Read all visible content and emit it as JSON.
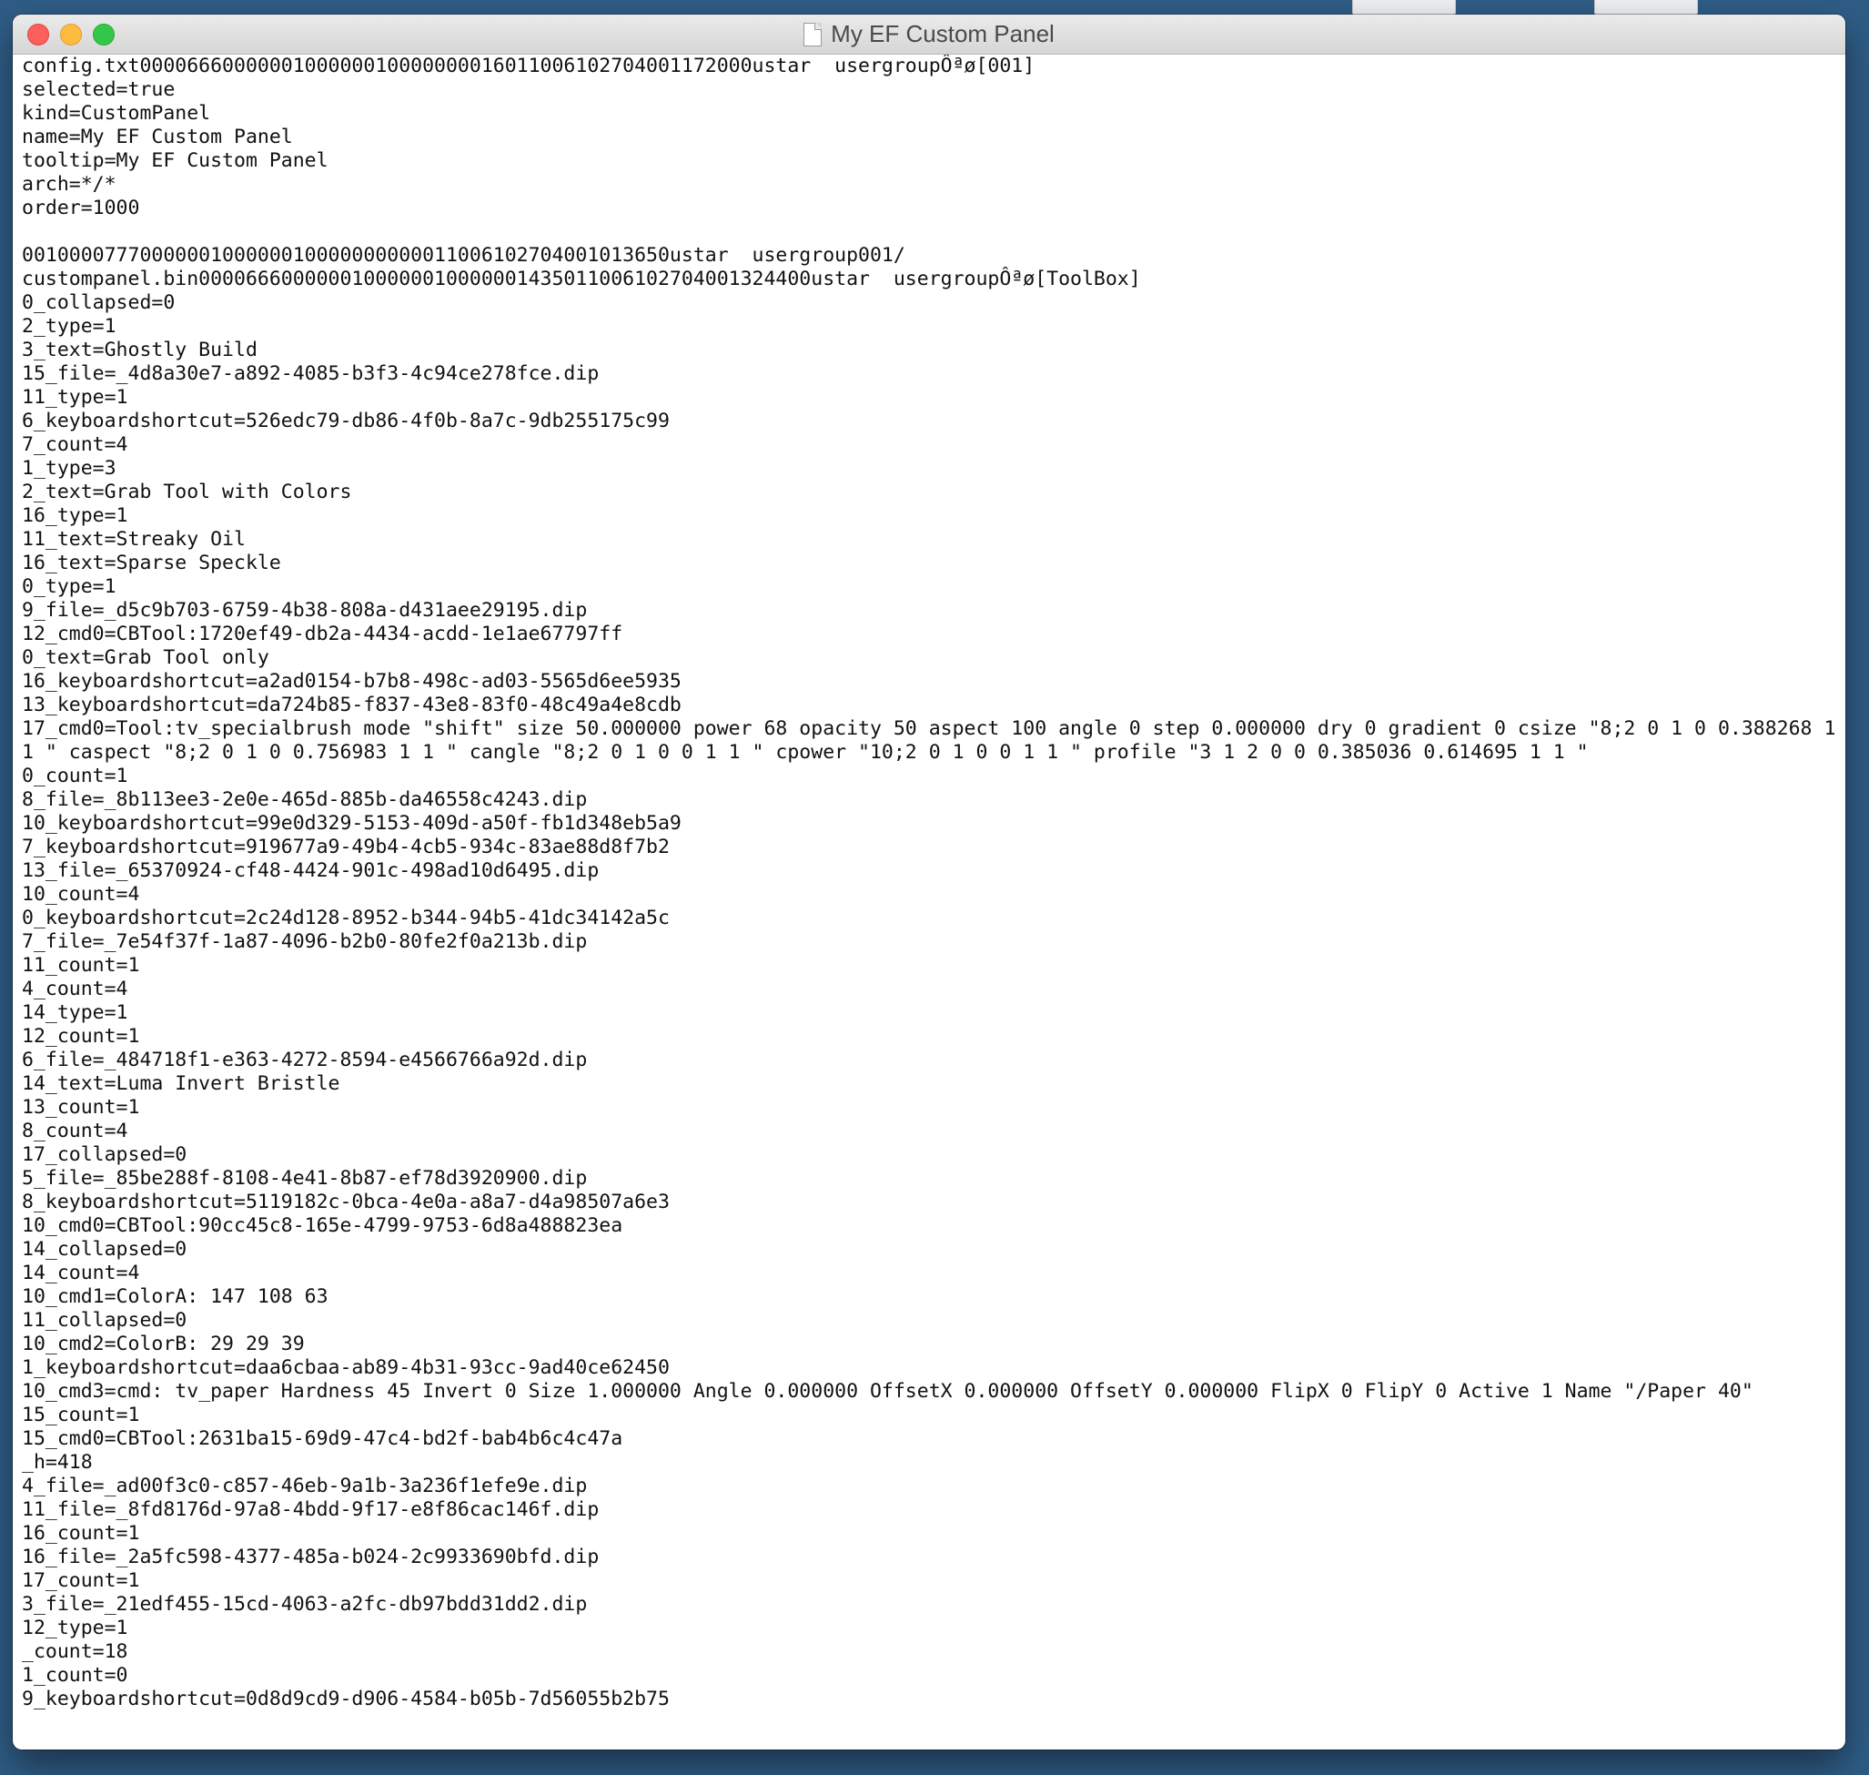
{
  "window": {
    "title": "My EF Custom Panel"
  },
  "document": {
    "text": "config.txt0000666000000100000010000000016011006102704001172000ustar  usergroupÔªø[001]\nselected=true\nkind=CustomPanel\nname=My EF Custom Panel\ntooltip=My EF Custom Panel\narch=*/*\norder=1000\n\n0010000777000000100000010000000000011006102704001013650ustar  usergroup001/\ncustompanel.bin0000666000000100000010000001435011006102704001324400ustar  usergroupÔªø[ToolBox]\n0_collapsed=0\n2_type=1\n3_text=Ghostly Build\n15_file=_4d8a30e7-a892-4085-b3f3-4c94ce278fce.dip\n11_type=1\n6_keyboardshortcut=526edc79-db86-4f0b-8a7c-9db255175c99\n7_count=4\n1_type=3\n2_text=Grab Tool with Colors\n16_type=1\n11_text=Streaky Oil\n16_text=Sparse Speckle\n0_type=1\n9_file=_d5c9b703-6759-4b38-808a-d431aee29195.dip\n12_cmd0=CBTool:1720ef49-db2a-4434-acdd-1e1ae67797ff\n0_text=Grab Tool only\n16_keyboardshortcut=a2ad0154-b7b8-498c-ad03-5565d6ee5935\n13_keyboardshortcut=da724b85-f837-43e8-83f0-48c49a4e8cdb\n17_cmd0=Tool:tv_specialbrush mode \"shift\" size 50.000000 power 68 opacity 50 aspect 100 angle 0 step 0.000000 dry 0 gradient 0 csize \"8;2 0 1 0 0.388268 1 1 \" caspect \"8;2 0 1 0 0.756983 1 1 \" cangle \"8;2 0 1 0 0 1 1 \" cpower \"10;2 0 1 0 0 1 1 \" profile \"3 1 2 0 0 0.385036 0.614695 1 1 \"\n0_count=1\n8_file=_8b113ee3-2e0e-465d-885b-da46558c4243.dip\n10_keyboardshortcut=99e0d329-5153-409d-a50f-fb1d348eb5a9\n7_keyboardshortcut=919677a9-49b4-4cb5-934c-83ae88d8f7b2\n13_file=_65370924-cf48-4424-901c-498ad10d6495.dip\n10_count=4\n0_keyboardshortcut=2c24d128-8952-b344-94b5-41dc34142a5c\n7_file=_7e54f37f-1a87-4096-b2b0-80fe2f0a213b.dip\n11_count=1\n4_count=4\n14_type=1\n12_count=1\n6_file=_484718f1-e363-4272-8594-e4566766a92d.dip\n14_text=Luma Invert Bristle\n13_count=1\n8_count=4\n17_collapsed=0\n5_file=_85be288f-8108-4e41-8b87-ef78d3920900.dip\n8_keyboardshortcut=5119182c-0bca-4e0a-a8a7-d4a98507a6e3\n10_cmd0=CBTool:90cc45c8-165e-4799-9753-6d8a488823ea\n14_collapsed=0\n14_count=4\n10_cmd1=ColorA: 147 108 63\n11_collapsed=0\n10_cmd2=ColorB: 29 29 39\n1_keyboardshortcut=daa6cbaa-ab89-4b31-93cc-9ad40ce62450\n10_cmd3=cmd: tv_paper Hardness 45 Invert 0 Size 1.000000 Angle 0.000000 OffsetX 0.000000 OffsetY 0.000000 FlipX 0 FlipY 0 Active 1 Name \"/Paper 40\"\n15_count=1\n15_cmd0=CBTool:2631ba15-69d9-47c4-bd2f-bab4b6c4c47a\n_h=418\n4_file=_ad00f3c0-c857-46eb-9a1b-3a236f1efe9e.dip\n11_file=_8fd8176d-97a8-4bdd-9f17-e8f86cac146f.dip\n16_count=1\n16_file=_2a5fc598-4377-485a-b024-2c9933690bfd.dip\n17_count=1\n3_file=_21edf455-15cd-4063-a2fc-db97bdd31dd2.dip\n12_type=1\n_count=18\n1_count=0\n9_keyboardshortcut=0d8d9cd9-d906-4584-b05b-7d56055b2b75"
  }
}
